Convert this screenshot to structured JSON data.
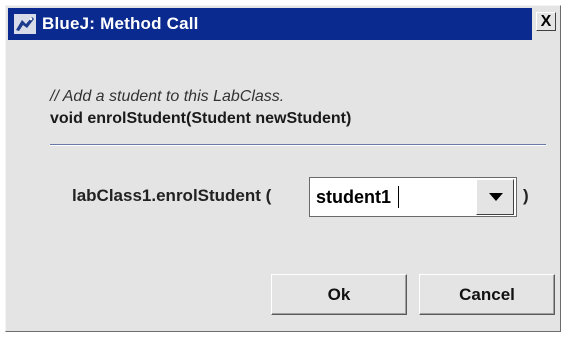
{
  "window": {
    "title": "BlueJ: Method Call",
    "close_label": "X",
    "title_icon": "bluej-bird-icon",
    "titlebar_color": "#0a2a8f"
  },
  "method": {
    "comment": "// Add a student to this LabClass.",
    "signature": "void enrolStudent(Student newStudent)"
  },
  "call": {
    "prefix": "labClass1.enrolStudent (",
    "argument_value": "student1",
    "suffix": ")",
    "dropdown_icon": "chevron-down-icon"
  },
  "buttons": {
    "ok_label": "Ok",
    "cancel_label": "Cancel"
  }
}
